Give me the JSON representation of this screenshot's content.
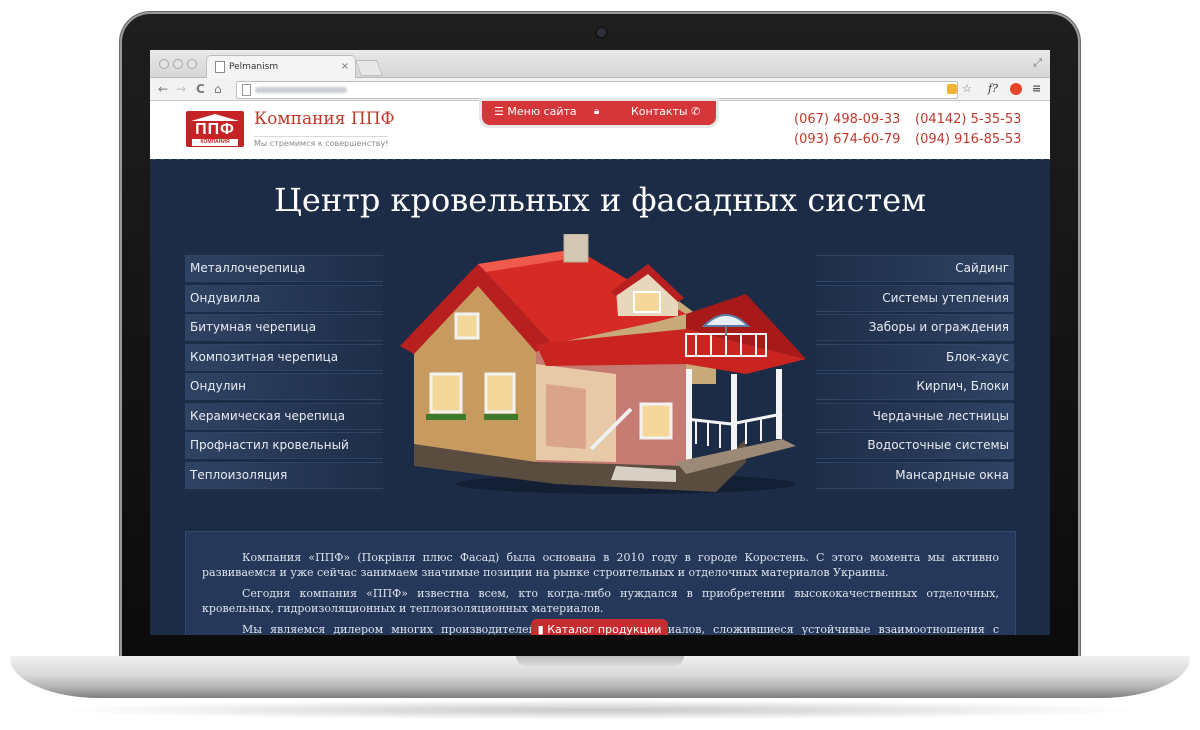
{
  "browser": {
    "tab_title": "Pelmanism",
    "tab_close": "×",
    "nav_back": "←",
    "nav_forward": "→",
    "nav_reload": "C",
    "nav_home": "⌂",
    "ext_bookmark": "☆",
    "ext_f": "f?",
    "ext_menu": "≡"
  },
  "header": {
    "logo_letters": "ППФ",
    "logo_small": "КОМПАНИЯ",
    "company_name": "Компания ППФ",
    "slogan": "Мы стремимся к совершенству!",
    "menu_site": "Меню сайта",
    "contacts": "Контакты",
    "phones": [
      "(067) 498-09-33",
      "(093) 674-60-79",
      "(04142) 5-35-53",
      "(094) 916-85-53"
    ]
  },
  "hero": {
    "title": "Центр кровельных и фасадных систем",
    "left_categories": [
      "Металлочерепица",
      "Ондувилла",
      "Битумная черепица",
      "Композитная черепица",
      "Ондулин",
      "Керамическая черепица",
      "Профнастил кровельный",
      "Теплоизоляция"
    ],
    "right_categories": [
      "Сайдинг",
      "Системы утепления",
      "Заборы и ограждения",
      "Блок-хаус",
      "Кирпич, Блоки",
      "Чердачные лестницы",
      "Водосточные системы",
      "Мансардные окна"
    ]
  },
  "about": {
    "paragraphs": [
      "Компания «ППФ» (Покрівля плюс Фасад) была основана в 2010 году в городе Коростень. С этого момента мы активно развиваемся и уже сейчас занимаем значимые позиции на рынке строительных и отделочных материалов Украины.",
      "Сегодня компания «ППФ» известна всем, кто когда-либо нуждался в приобретении высококачественных отделочных, кровельных, гидроизоляционных и теплоизоляционных материалов.",
      "Мы являемся дилером многих производителей строительных материалов, сложившиеся устойчивые взаимоотношения с основными"
    ],
    "catalog_button": "Каталог продукции"
  },
  "colors": {
    "accent": "#d5363a",
    "background": "#1d2c46",
    "text_red": "#c0392b"
  }
}
